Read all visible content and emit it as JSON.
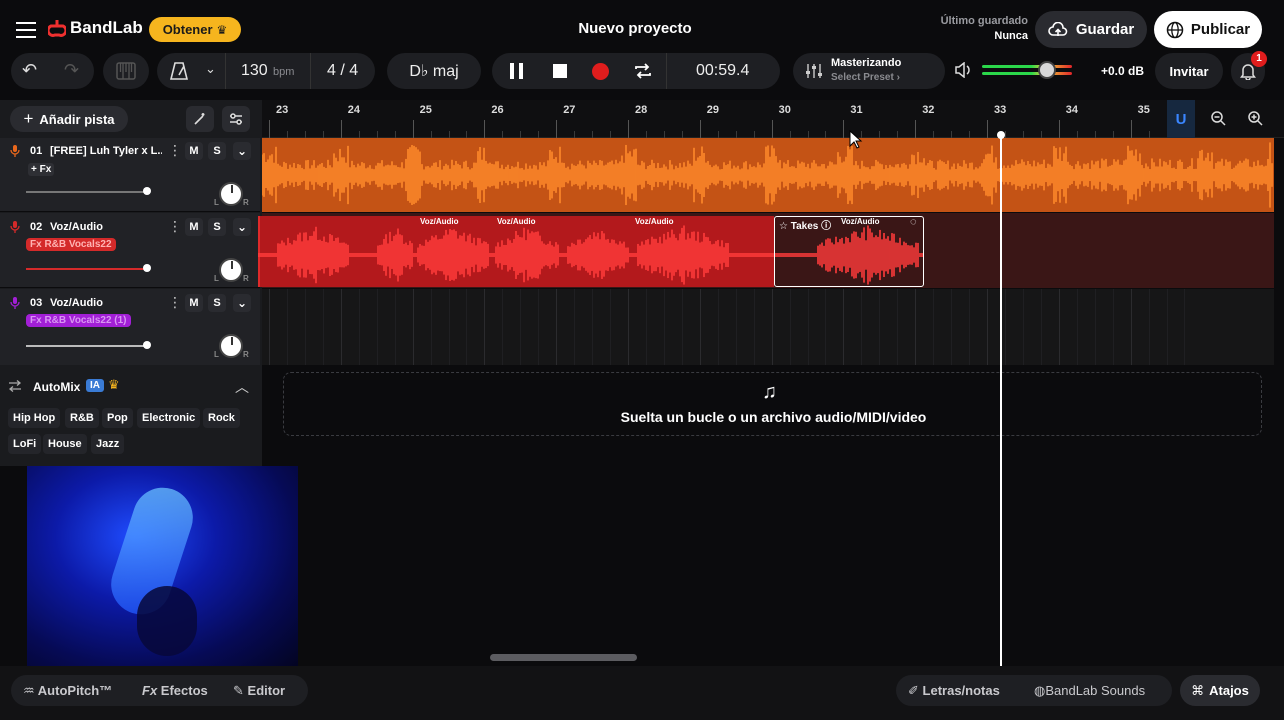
{
  "header": {
    "brand": "BandLab",
    "get_label": "Obtener",
    "title": "Nuevo proyecto",
    "last_saved_label": "Último guardado",
    "last_saved_value": "Nunca",
    "save_label": "Guardar",
    "publish_label": "Publicar"
  },
  "transport": {
    "bpm": "130",
    "bpm_unit": "bpm",
    "time_sig": "4 / 4",
    "key": "D♭ maj",
    "time": "00:59.4",
    "mastering_title": "Masterizando",
    "mastering_preset": "Select Preset",
    "volume_db": "+0.0 dB",
    "volume_level": 0.72,
    "invite_label": "Invitar",
    "notif_count": "1"
  },
  "toolbar": {
    "add_track": "Añadir pista"
  },
  "timeline": {
    "bars": [
      "23",
      "24",
      "25",
      "26",
      "27",
      "28",
      "29",
      "30",
      "31",
      "32",
      "33",
      "34",
      "35"
    ]
  },
  "tracks": [
    {
      "num": "01",
      "name": "[FREE] Luh Tyler x L...",
      "fx": "+ Fx",
      "m": "M",
      "s": "S",
      "color": "#e8671c"
    },
    {
      "num": "02",
      "name": "Voz/Audio",
      "fx": "Fx R&B Vocals22",
      "m": "M",
      "s": "S",
      "color": "#d42a2a"
    },
    {
      "num": "03",
      "name": "Voz/Audio",
      "fx": "Fx R&B Vocals22 (1)",
      "m": "M",
      "s": "S",
      "color": "#a21fd6"
    }
  ],
  "clips": {
    "label": "Voz/Audio",
    "takes": "Takes"
  },
  "pan": {
    "l": "L",
    "r": "R"
  },
  "automix": {
    "title": "AutoMix",
    "badge": "IA",
    "genres": [
      "Hip Hop",
      "R&B",
      "Pop",
      "Electronic",
      "Rock",
      "LoFi",
      "House",
      "Jazz"
    ]
  },
  "dropzone": {
    "text": "Suelta un bucle o un archivo audio/MIDI/video"
  },
  "bottom": {
    "autopitch": "AutoPitch™",
    "effects": "Efectos",
    "editor": "Editor",
    "lyrics": "Letras/notas",
    "sounds": "BandLab Sounds",
    "shortcuts": "Atajos"
  },
  "colors": {
    "accent_orange": "#e8671c",
    "accent_red": "#d42a2a",
    "accent_purple": "#a21fd6",
    "brand_red": "#f0302f",
    "get_yellow": "#f6b51e"
  }
}
